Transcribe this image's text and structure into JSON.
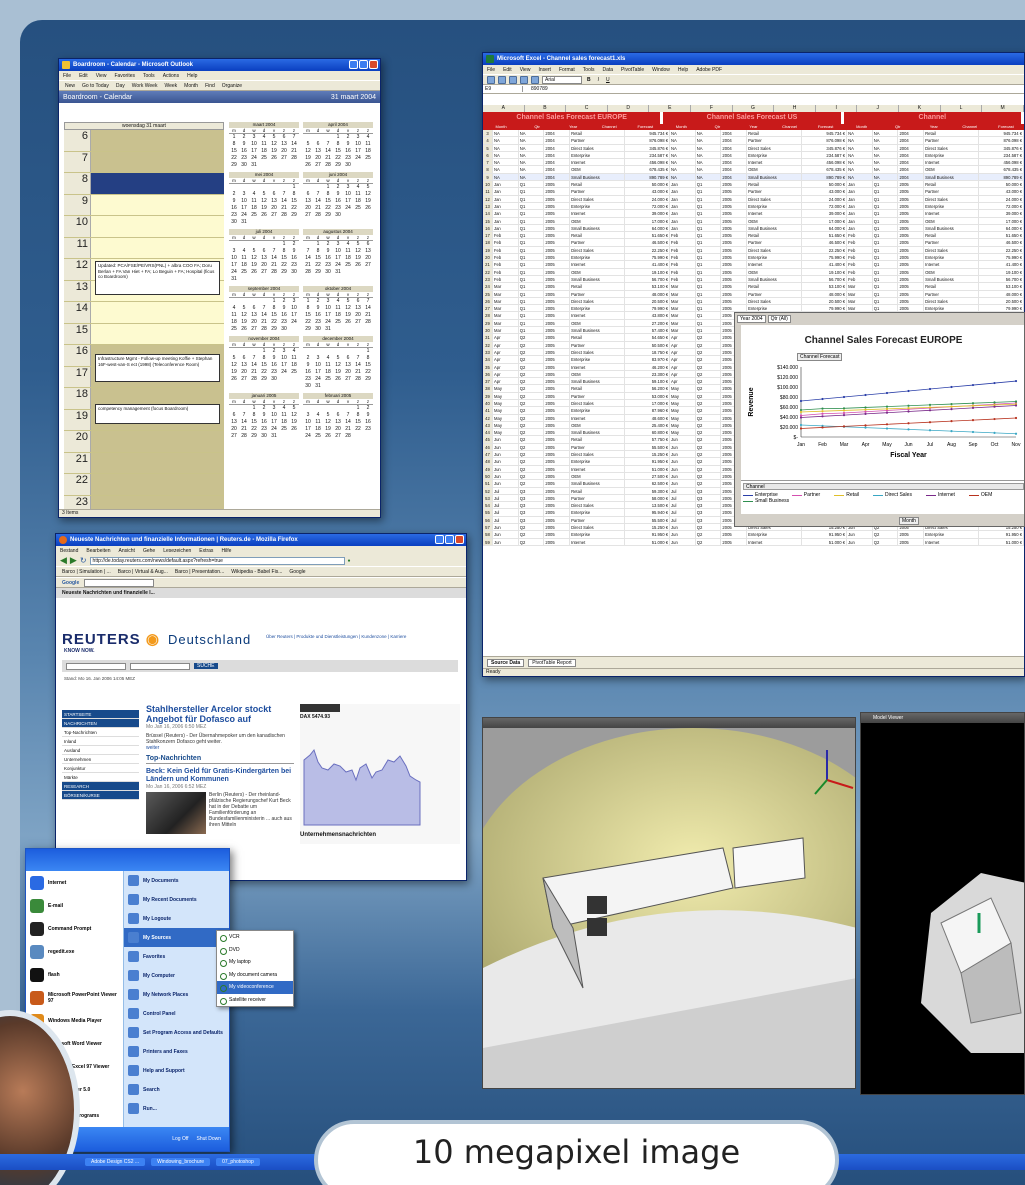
{
  "caption": "10 megapixel image",
  "outlook": {
    "title": "Boardroom - Calendar - Microsoft Outlook",
    "menu": [
      "File",
      "Edit",
      "View",
      "Favorites",
      "Tools",
      "Actions",
      "Help"
    ],
    "toolbar": [
      "New",
      "Go to Today",
      "Day",
      "Work Week",
      "Week",
      "Month",
      "Find",
      "Organize"
    ],
    "folder_title": "Boardroom - Calendar",
    "date_title": "31 maart 2004",
    "day_header": "woensdag 31 maart",
    "hours": [
      "6",
      "7",
      "8",
      "9",
      "10",
      "11",
      "12",
      "13",
      "14",
      "15",
      "16",
      "17",
      "18",
      "19",
      "20",
      "21",
      "22",
      "23"
    ],
    "appointments": [
      "Updated: PCA/FSE/PE/VRS(PNL) + albra COO FA; Doru Berlan + FA Van Hiet + FA; Lo Beguin + FA; Hospital (ficus co Boardroom)",
      "Infrastructure Mgmt - Follow-up meeting Koffie + Stephan 16F-west-van-S ect (1998) (Teleconference Room)",
      "competency management (focus Boardroom)"
    ],
    "months": [
      {
        "name": "maart 2004",
        "days": "1 2 3 4 5 6 7 8 9 10 11 12 13 14 15 16 17 18 19 20 21 22 23 24 25 26 27 28 29 30 31"
      },
      {
        "name": "april 2004",
        "days": "1 2 3 4 5 6 7 8 9 10 11 12 13 14 15 16 17 18 19 20 21 22 23 24 25 26 27 28 29 30"
      },
      {
        "name": "mei 2004",
        "days": "1 2 3 4 5 6 7 8 9 10 11 12 13 14 15 16 17 18 19 20 21 22 23 24 25 26 27 28 29 30 31"
      },
      {
        "name": "juni 2004",
        "days": "1 2 3 4 5 6 7 8 9 10 11 12 13 14 15 16 17 18 19 20 21 22 23 24 25 26 27 28 29 30"
      },
      {
        "name": "juli 2004",
        "days": "1 2 3 4 5 6 7 8 9 10 11 12 13 14 15 16 17 18 19 20 21 22 23 24 25 26 27 28 29 30 31"
      },
      {
        "name": "augustus 2004",
        "days": "1 2 3 4 5 6 7 8 9 10 11 12 13 14 15 16 17 18 19 20 21 22 23 24 25 26 27 28 29 30 31"
      },
      {
        "name": "september 2004",
        "days": "1 2 3 4 5 6 7 8 9 10 11 12 13 14 15 16 17 18 19 20 21 22 23 24 25 26 27 28 29 30"
      },
      {
        "name": "oktober 2004",
        "days": "1 2 3 4 5 6 7 8 9 10 11 12 13 14 15 16 17 18 19 20 21 22 23 24 25 26 27 28 29 30 31"
      },
      {
        "name": "november 2004",
        "days": "1 2 3 4 5 6 7 8 9 10 11 12 13 14 15 16 17 18 19 20 21 22 23 24 25 26 27 28 29 30"
      },
      {
        "name": "december 2004",
        "days": "1 2 3 4 5 6 7 8 9 10 11 12 13 14 15 16 17 18 19 20 21 22 23 24 25 26 27 28 29 30 31"
      },
      {
        "name": "januari 2005",
        "days": "1 2 3 4 5 6 7 8 9 10 11 12 13 14 15 16 17 18 19 20 21 22 23 24 25 26 27 28 29 30 31"
      },
      {
        "name": "februari 2005",
        "days": "1 2 3 4 5 6 7 8 9 10 11 12 13 14 15 16 17 18 19 20 21 22 23 24 25 26 27 28"
      }
    ],
    "weekdays": [
      "m",
      "d",
      "w",
      "d",
      "v",
      "z",
      "z"
    ],
    "status": "3 Items"
  },
  "excel": {
    "title": "Microsoft Excel - Channel sales forecast1.xls",
    "menu": [
      "File",
      "Edit",
      "View",
      "Insert",
      "Format",
      "Tools",
      "Data",
      "PivotTable",
      "Window",
      "Help",
      "Adobe PDF"
    ],
    "font": "Arial",
    "cell_ref": "E9",
    "formula": "890789",
    "col_letters": [
      "A",
      "B",
      "C",
      "D",
      "E",
      "F",
      "G",
      "H",
      "I",
      "J",
      "K",
      "L",
      "M"
    ],
    "bands": [
      "Channel Sales Forecast EUROPE",
      "Channel Sales Forecast US",
      "Channel"
    ],
    "headers": [
      "Month",
      "Qtr",
      "Year",
      "Channel",
      "Forecast"
    ],
    "rows": [
      [
        "NA",
        "NA",
        "2004",
        "Retail",
        "945.734 €"
      ],
      [
        "NA",
        "NA",
        "2004",
        "Partner",
        "876.098 €"
      ],
      [
        "NA",
        "NA",
        "2004",
        "Direct Sales",
        "345.876 €"
      ],
      [
        "NA",
        "NA",
        "2004",
        "Enterprise",
        "234.587 €"
      ],
      [
        "NA",
        "NA",
        "2004",
        "Internet",
        "456.098 €"
      ],
      [
        "NA",
        "NA",
        "2004",
        "OEM",
        "678.435 €"
      ],
      [
        "NA",
        "NA",
        "2004",
        "Small Business",
        "890.789 €"
      ],
      [
        "Jan",
        "Q1",
        "2005",
        "Retail",
        "50.000 €"
      ],
      [
        "Jan",
        "Q1",
        "2005",
        "Partner",
        "43.000 €"
      ],
      [
        "Jan",
        "Q1",
        "2005",
        "Direct Sales",
        "24.000 €"
      ],
      [
        "Jan",
        "Q1",
        "2005",
        "Enterprise",
        "72.000 €"
      ],
      [
        "Jan",
        "Q1",
        "2005",
        "Internet",
        "39.000 €"
      ],
      [
        "Jan",
        "Q1",
        "2005",
        "OEM",
        "17.000 €"
      ],
      [
        "Jan",
        "Q1",
        "2005",
        "Small Business",
        "64.000 €"
      ],
      [
        "Feb",
        "Q1",
        "2005",
        "Retail",
        "51.650 €"
      ],
      [
        "Feb",
        "Q1",
        "2005",
        "Partner",
        "46.500 €"
      ],
      [
        "Feb",
        "Q1",
        "2005",
        "Direct Sales",
        "22.250 €"
      ],
      [
        "Feb",
        "Q1",
        "2005",
        "Enterprise",
        "75.990 €"
      ],
      [
        "Feb",
        "Q1",
        "2005",
        "Internet",
        "41.400 €"
      ],
      [
        "Feb",
        "Q1",
        "2005",
        "OEM",
        "19.100 €"
      ],
      [
        "Feb",
        "Q1",
        "2005",
        "Small Business",
        "56.700 €"
      ],
      [
        "Mar",
        "Q1",
        "2005",
        "Retail",
        "53.100 €"
      ],
      [
        "Mar",
        "Q1",
        "2005",
        "Partner",
        "48.000 €"
      ],
      [
        "Mar",
        "Q1",
        "2005",
        "Direct Sales",
        "20.500 €"
      ],
      [
        "Mar",
        "Q1",
        "2005",
        "Enterprise",
        "79.990 €"
      ],
      [
        "Mar",
        "Q1",
        "2005",
        "Internet",
        "43.800 €"
      ],
      [
        "Mar",
        "Q1",
        "2005",
        "OEM",
        "27.200 €"
      ],
      [
        "Mar",
        "Q1",
        "2005",
        "Small Business",
        "57.400 €"
      ],
      [
        "Apr",
        "Q2",
        "2005",
        "Retail",
        "54.650 €"
      ],
      [
        "Apr",
        "Q2",
        "2005",
        "Partner",
        "50.500 €"
      ],
      [
        "Apr",
        "Q2",
        "2005",
        "Direct Sales",
        "18.750 €"
      ],
      [
        "Apr",
        "Q2",
        "2005",
        "Enterprise",
        "83.970 €"
      ],
      [
        "Apr",
        "Q2",
        "2005",
        "Internet",
        "46.200 €"
      ],
      [
        "Apr",
        "Q2",
        "2005",
        "OEM",
        "23.300 €"
      ],
      [
        "Apr",
        "Q2",
        "2005",
        "Small Business",
        "59.100 €"
      ],
      [
        "May",
        "Q2",
        "2005",
        "Retail",
        "56.200 €"
      ],
      [
        "May",
        "Q2",
        "2005",
        "Partner",
        "53.000 €"
      ],
      [
        "May",
        "Q2",
        "2005",
        "Direct Sales",
        "17.000 €"
      ],
      [
        "May",
        "Q2",
        "2005",
        "Enterprise",
        "87.960 €"
      ],
      [
        "May",
        "Q2",
        "2005",
        "Internet",
        "48.600 €"
      ],
      [
        "May",
        "Q2",
        "2005",
        "OEM",
        "25.400 €"
      ],
      [
        "May",
        "Q2",
        "2005",
        "Small Business",
        "60.800 €"
      ],
      [
        "Jun",
        "Q2",
        "2005",
        "Retail",
        "57.750 €"
      ],
      [
        "Jun",
        "Q2",
        "2005",
        "Partner",
        "55.500 €"
      ],
      [
        "Jun",
        "Q2",
        "2005",
        "Direct Sales",
        "15.250 €"
      ],
      [
        "Jun",
        "Q2",
        "2005",
        "Enterprise",
        "91.950 €"
      ],
      [
        "Jun",
        "Q2",
        "2005",
        "Internet",
        "51.000 €"
      ],
      [
        "Jun",
        "Q2",
        "2005",
        "OEM",
        "27.500 €"
      ],
      [
        "Jun",
        "Q2",
        "2005",
        "Small Business",
        "62.500 €"
      ],
      [
        "Jul",
        "Q3",
        "2005",
        "Retail",
        "59.300 €"
      ],
      [
        "Jul",
        "Q3",
        "2005",
        "Partner",
        "58.000 €"
      ],
      [
        "Jul",
        "Q3",
        "2005",
        "Direct Sales",
        "13.500 €"
      ],
      [
        "Jul",
        "Q3",
        "2005",
        "Enterprise",
        "95.940 €"
      ],
      [
        "Jul",
        "Q3",
        "2005",
        "Partner",
        "55.500 €"
      ],
      [
        "Jun",
        "Q2",
        "2005",
        "Direct Sales",
        "15.250 €"
      ],
      [
        "Jun",
        "Q2",
        "2005",
        "Enterprise",
        "91.950 €"
      ],
      [
        "Jun",
        "Q2",
        "2005",
        "Internet",
        "51.000 €"
      ]
    ],
    "sheet_tabs": [
      "Source Data",
      "PivotTable Report"
    ],
    "status": "Ready"
  },
  "pivot": {
    "filters": [
      "Year 2004",
      "Qtr (All)"
    ],
    "field_button": "Channel Forecast",
    "channel_label": "Channel",
    "month_button": "Month"
  },
  "chart_data": {
    "type": "line",
    "title": "Channel Sales Forecast EUROPE",
    "xlabel": "Fiscal Year",
    "ylabel": "Revenue",
    "categories": [
      "Jan",
      "Feb",
      "Mar",
      "Apr",
      "May",
      "Jun",
      "Jul",
      "Aug",
      "Sep",
      "Oct",
      "Nov"
    ],
    "ytick_labels": [
      "$140.000",
      "$120.000",
      "$100.000",
      "$80.000",
      "$60.000",
      "$40.000",
      "$20.000",
      "$-"
    ],
    "ylim": [
      0,
      140000
    ],
    "series": [
      {
        "name": "Enterprise",
        "color": "#2b3fa8",
        "values": [
          72000,
          75990,
          79990,
          83970,
          87960,
          91950,
          95940,
          99930,
          103920,
          107910,
          111900
        ]
      },
      {
        "name": "Partner",
        "color": "#d44fb0",
        "values": [
          43000,
          46500,
          48000,
          50500,
          53000,
          55500,
          58000,
          60500,
          63000,
          65500,
          68000
        ]
      },
      {
        "name": "Retail",
        "color": "#e0c02a",
        "values": [
          50000,
          51650,
          53100,
          54650,
          56200,
          57750,
          59300,
          60850,
          62400,
          63950,
          65500
        ]
      },
      {
        "name": "Direct Sales",
        "color": "#39a7c4",
        "values": [
          24000,
          22250,
          20500,
          18750,
          17000,
          15250,
          13500,
          11750,
          10000,
          8250,
          6500
        ]
      },
      {
        "name": "Internet",
        "color": "#7a2a8a",
        "values": [
          39000,
          41400,
          43800,
          46200,
          48600,
          51000,
          53400,
          55800,
          58200,
          60600,
          63000
        ]
      },
      {
        "name": "OEM",
        "color": "#b8321e",
        "values": [
          17000,
          19100,
          21200,
          23300,
          25400,
          27500,
          29600,
          31700,
          33800,
          35900,
          38000
        ]
      },
      {
        "name": "Small Business",
        "color": "#2f8f4f",
        "values": [
          54000,
          56700,
          57400,
          59100,
          60800,
          62500,
          64200,
          65900,
          67600,
          69300,
          71000
        ]
      }
    ],
    "legend": "bottom",
    "grid": false
  },
  "reuters": {
    "title": "Neueste Nachrichten und finanzielle Informationen | Reuters.de - Mozilla Firefox",
    "menu": [
      "Bestand",
      "Bearbeiten",
      "Ansicht",
      "Gehe",
      "Lesezeichen",
      "Extras",
      "Hilfe"
    ],
    "url": "http://de.today.reuters.com/news/default.aspx?refresh=true",
    "bookmarks": [
      "Barco | Simulation | ...",
      "Barco | Virtual & Aug...",
      "Barco | Presentation...",
      "Wikipedia - Babel Fis...",
      "Google"
    ],
    "tab": "Neueste Nachrichten und finanzielle I...",
    "brand": "REUTERS",
    "brand_suffix": "Deutschland",
    "tagline": "KNOW NOW.",
    "top_links": "Über Reuters | Produkte und Dienstleistungen | Kundenzone | Karriere",
    "search_btn": "SUCHE",
    "date_line": "Stand: Mo 16. Jan 2006 14:05 MEZ",
    "side": [
      "STARTSEITE",
      "NACHRICHTEN",
      "Top-Nachrichten",
      "Inland",
      "Ausland",
      "Unternehmen",
      "Konjunktur",
      "Märkte",
      "RESEARCH",
      "BÖRSEN/KURSE"
    ],
    "headline": "Stahlhersteller Arcelor stockt Angebot für Dofasco auf",
    "headline_date": "Mo Jan 16, 2006 6:50 MEZ",
    "lead": "Brüssel (Reuters) - Der Übernahmepoker um den kanadischen Stahlkonzern Dofasco geht weiter.",
    "more": "weiter",
    "section": "Top-Nachrichten",
    "story2": "Beck: Kein Geld für Gratis-Kindergärten bei Ländern und Kommunen",
    "story2_date": "Mo Jan 16, 2006 6:52 MEZ",
    "story2_lead": "Berlin (Reuters) - Der rheinland-pfälzische Regierungschef Kurt Beck hat in der Debatte um Familienförderung an Bundesfamilienministerin ... auch aus ihren Mitteln",
    "dax": "DAX  5474.93",
    "companies": "Unternehmensnachrichten"
  },
  "startmenu": {
    "left": [
      "Internet",
      "E-mail",
      "Command Prompt",
      "regedit.exe",
      "flash",
      "Microsoft PowerPoint Viewer 97",
      "Windows Media Player",
      "Microsoft Word Viewer",
      "Microsoft Excel 97 Viewer",
      "Adobe Reader 5.0",
      "All Programs"
    ],
    "right": [
      "My Documents",
      "My Recent Documents",
      "My Logoute",
      "My Sources",
      "Favorites",
      "My Computer",
      "My Network Places",
      "Control Panel",
      "Set Program Access and Defaults",
      "Printers and Faxes",
      "Help and Support",
      "Search",
      "Run..."
    ],
    "sources": [
      "VCR",
      "DVD",
      "My laptop",
      "My document camera",
      "My videoconference",
      "Satellite receiver"
    ],
    "logoff": "Log Off",
    "shutdown": "Shut Down"
  },
  "taskbar": [
    "Adobe Design CS2 ...",
    "Windowing_brochure",
    "07_photoshop"
  ],
  "view3d2_title": "Model Viewer"
}
